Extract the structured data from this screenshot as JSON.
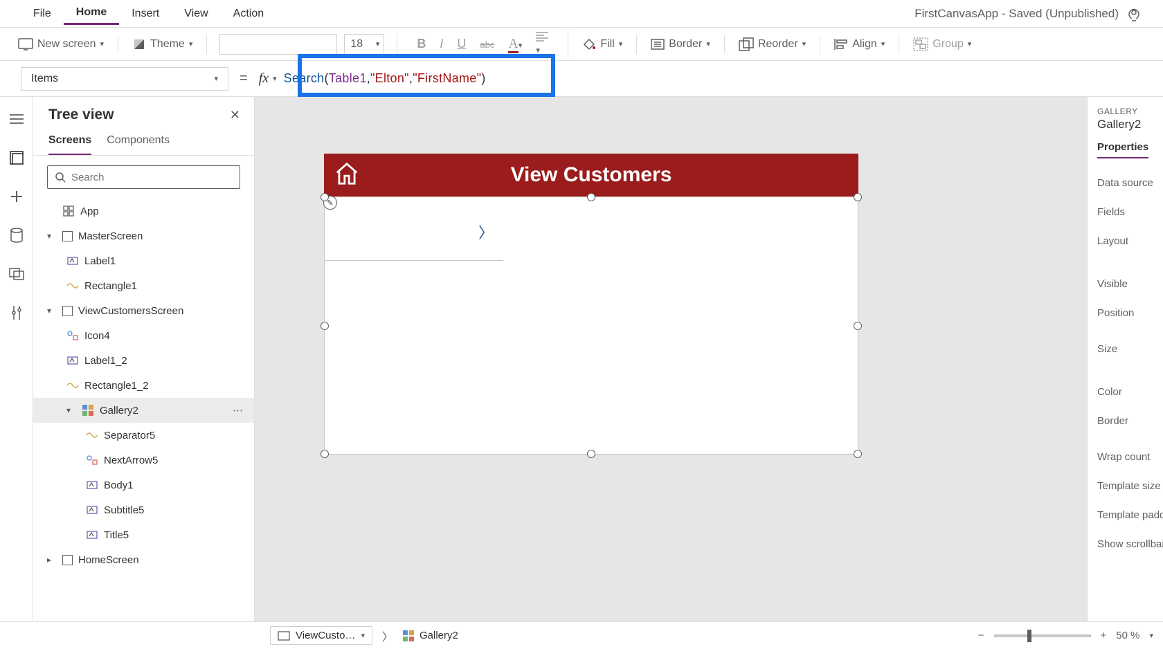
{
  "menu": {
    "file": "File",
    "home": "Home",
    "insert": "Insert",
    "view": "View",
    "action": "Action"
  },
  "appTitle": "FirstCanvasApp - Saved (Unpublished)",
  "ribbon": {
    "newScreen": "New screen",
    "theme": "Theme",
    "fontSize": "18",
    "fill": "Fill",
    "border": "Border",
    "reorder": "Reorder",
    "align": "Align",
    "group": "Group"
  },
  "formula": {
    "property": "Items",
    "fn": "Search",
    "id": "Table1",
    "str1": "\"Elton\"",
    "str2": "\"FirstName\""
  },
  "tree": {
    "title": "Tree view",
    "tabs": {
      "screens": "Screens",
      "components": "Components"
    },
    "searchPlaceholder": "Search",
    "items": [
      {
        "label": "App"
      },
      {
        "label": "MasterScreen"
      },
      {
        "label": "Label1"
      },
      {
        "label": "Rectangle1"
      },
      {
        "label": "ViewCustomersScreen"
      },
      {
        "label": "Icon4"
      },
      {
        "label": "Label1_2"
      },
      {
        "label": "Rectangle1_2"
      },
      {
        "label": "Gallery2"
      },
      {
        "label": "Separator5"
      },
      {
        "label": "NextArrow5"
      },
      {
        "label": "Body1"
      },
      {
        "label": "Subtitle5"
      },
      {
        "label": "Title5"
      },
      {
        "label": "HomeScreen"
      }
    ]
  },
  "canvas": {
    "headerTitle": "View Customers"
  },
  "props": {
    "typeLabel": "GALLERY",
    "name": "Gallery2",
    "tab": "Properties",
    "rows": [
      "Data source",
      "Fields",
      "Layout",
      "Visible",
      "Position",
      "Size",
      "Color",
      "Border",
      "Wrap count",
      "Template size",
      "Template padding",
      "Show scrollbar"
    ]
  },
  "status": {
    "crumb1": "ViewCusto…",
    "crumb2": "Gallery2",
    "zoomPct": "50 %",
    "zoomMinus": "−",
    "zoomPlus": "+"
  }
}
